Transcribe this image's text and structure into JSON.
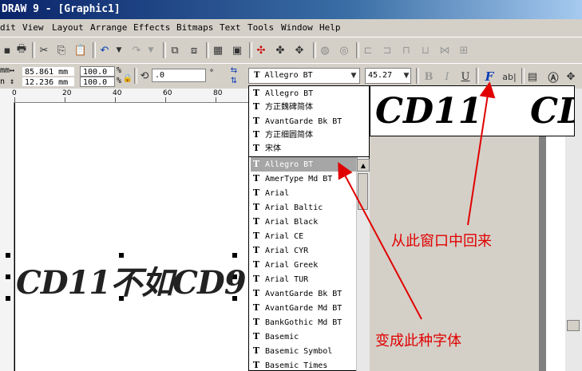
{
  "window": {
    "title": "DRAW 9 - [Graphic1]"
  },
  "menu": [
    {
      "label": "dit"
    },
    {
      "label": "View"
    },
    {
      "label": "Layout"
    },
    {
      "label": "Arrange"
    },
    {
      "label": "Effects"
    },
    {
      "label": "Bitmaps"
    },
    {
      "label": "Text"
    },
    {
      "label": "Tools"
    },
    {
      "label": "Window"
    },
    {
      "label": "Help"
    }
  ],
  "property_bar": {
    "width_value": "85.861 mm",
    "height_value": "12.236 mm",
    "scale_x": "100.0",
    "scale_y": "100.0",
    "percent_sign": "%",
    "rotation_value": ".0",
    "degree_sign": "°",
    "font_name": "Allegro BT",
    "font_size": "45.27",
    "bold_label": "B",
    "italic_label": "I",
    "underline_label": "U",
    "format_label": "F",
    "ab_label": "ab|"
  },
  "ruler": {
    "h_labels": [
      "0",
      "20",
      "40",
      "60",
      "80"
    ]
  },
  "canvas": {
    "text": "CD11不如CD9"
  },
  "font_dropdown": {
    "recent": [
      "Allegro BT",
      "方正魏碑简体",
      "AvantGarde Bk BT",
      "方正细圆简体",
      "宋体"
    ],
    "all": [
      "Allegro BT",
      "AmerType Md BT",
      "Arial",
      "Arial Baltic",
      "Arial Black",
      "Arial CE",
      "Arial CYR",
      "Arial Greek",
      "Arial TUR",
      "AvantGarde Bk BT",
      "AvantGarde Md BT",
      "BankGothic Md BT",
      "Basemic",
      "Basemic Symbol",
      "Basemic Times"
    ],
    "selected": "Allegro BT",
    "item_icon": "T"
  },
  "preview": {
    "sample1": "CD11",
    "sample2": "CD"
  },
  "annotations": {
    "back_from_window": "从此窗口中回来",
    "becomes_this_font": "变成此种字体",
    "color": "#e00000"
  }
}
